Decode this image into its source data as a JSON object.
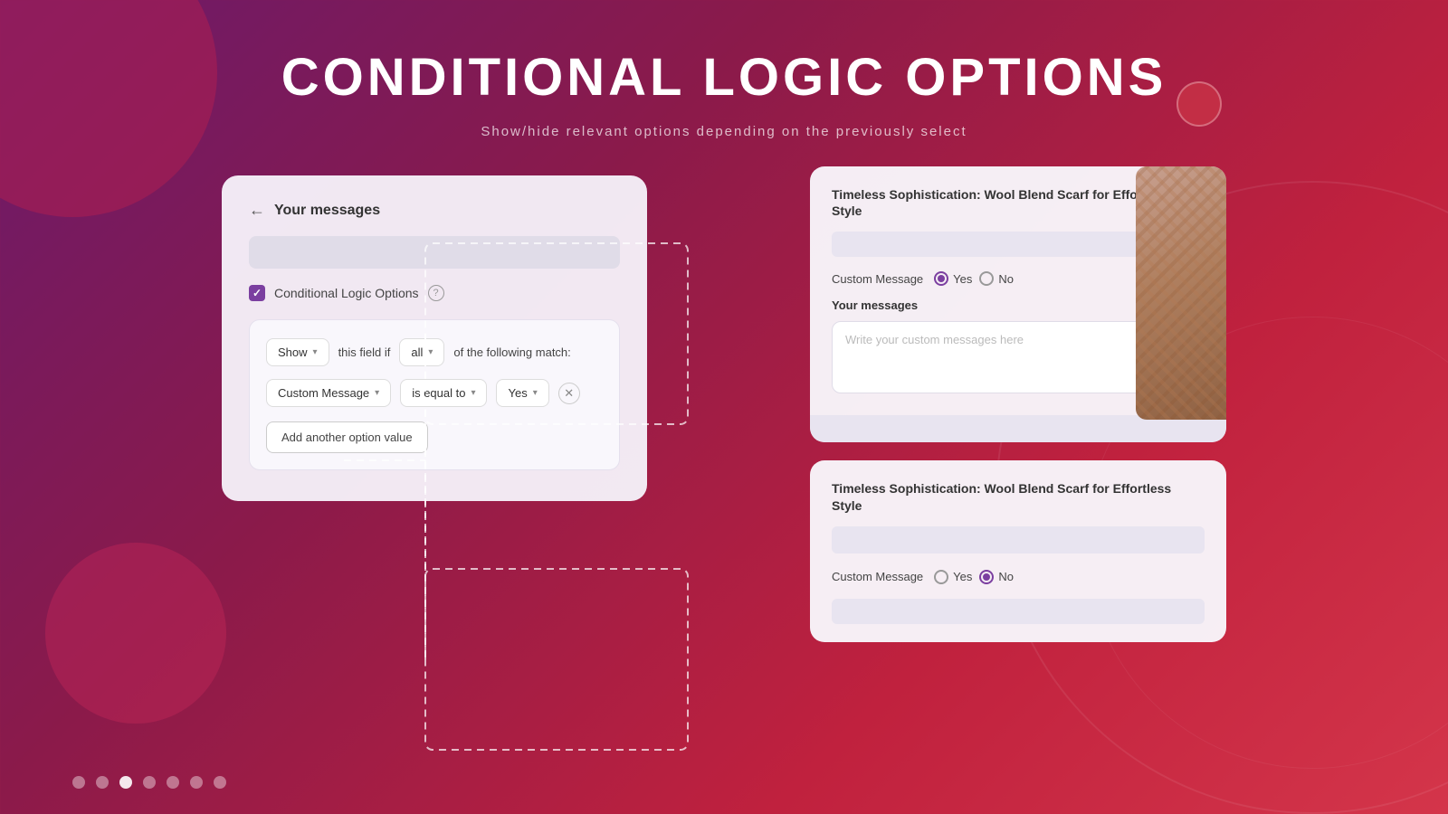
{
  "page": {
    "title": "CONDITIONAL LOGIC OPTIONS",
    "subtitle": "Show/hide relevant options depending on the previously select"
  },
  "left_panel": {
    "back_label": "←",
    "title": "Your messages",
    "checkbox_label": "Conditional Logic Options",
    "condition": {
      "show_label": "Show",
      "this_field": "this field if",
      "all_label": "all",
      "following_text": "of the following match:",
      "field_label": "Custom Message",
      "operator_label": "is equal to",
      "value_label": "Yes",
      "add_option_label": "Add another option value"
    }
  },
  "top_card": {
    "product_title": "Timeless Sophistication: Wool Blend Scarf for Effortless Style",
    "custom_message_label": "Custom Message",
    "yes_label": "Yes",
    "no_label": "No",
    "your_messages_label": "Your messages",
    "textarea_placeholder": "Write your custom messages here",
    "yes_selected": true
  },
  "bottom_card": {
    "product_title": "Timeless Sophistication: Wool Blend Scarf for Effortless Style",
    "custom_message_label": "Custom Message",
    "yes_label": "Yes",
    "no_label": "No",
    "no_selected": true
  },
  "dots": [
    {
      "active": false
    },
    {
      "active": false
    },
    {
      "active": true
    },
    {
      "active": false
    },
    {
      "active": false
    },
    {
      "active": false
    },
    {
      "active": false
    }
  ],
  "colors": {
    "accent": "#7b3fa0",
    "background_gradient_start": "#6b1a6b",
    "background_gradient_end": "#d4354a"
  }
}
